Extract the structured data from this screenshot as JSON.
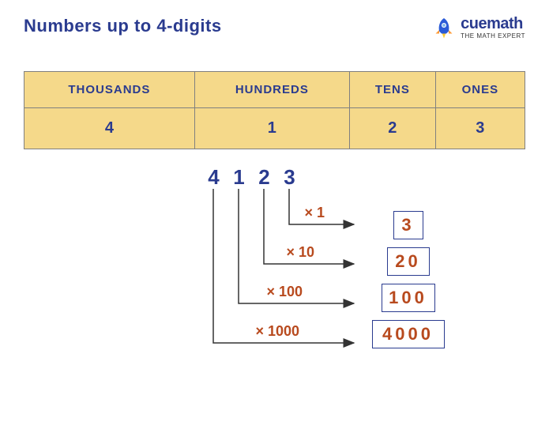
{
  "title": "Numbers up to 4-digits",
  "brand": {
    "name": "cuemath",
    "tagline": "THE MATH EXPERT"
  },
  "table": {
    "headers": [
      "THOUSANDS",
      "HUNDREDS",
      "TENS",
      "ONES"
    ],
    "values": [
      "4",
      "1",
      "2",
      "3"
    ]
  },
  "number": [
    "4",
    "1",
    "2",
    "3"
  ],
  "expansion": [
    {
      "mult": "× 1",
      "result": "3"
    },
    {
      "mult": "× 10",
      "result": "20"
    },
    {
      "mult": "× 100",
      "result": "100"
    },
    {
      "mult": "× 1000",
      "result": "4000"
    }
  ],
  "chart_data": {
    "type": "table",
    "title": "Numbers up to 4-digits",
    "number": 4123,
    "place_values": [
      {
        "place": "THOUSANDS",
        "digit": 4,
        "multiplier": 1000,
        "value": 4000
      },
      {
        "place": "HUNDREDS",
        "digit": 1,
        "multiplier": 100,
        "value": 100
      },
      {
        "place": "TENS",
        "digit": 2,
        "multiplier": 10,
        "value": 20
      },
      {
        "place": "ONES",
        "digit": 3,
        "multiplier": 1,
        "value": 3
      }
    ]
  }
}
